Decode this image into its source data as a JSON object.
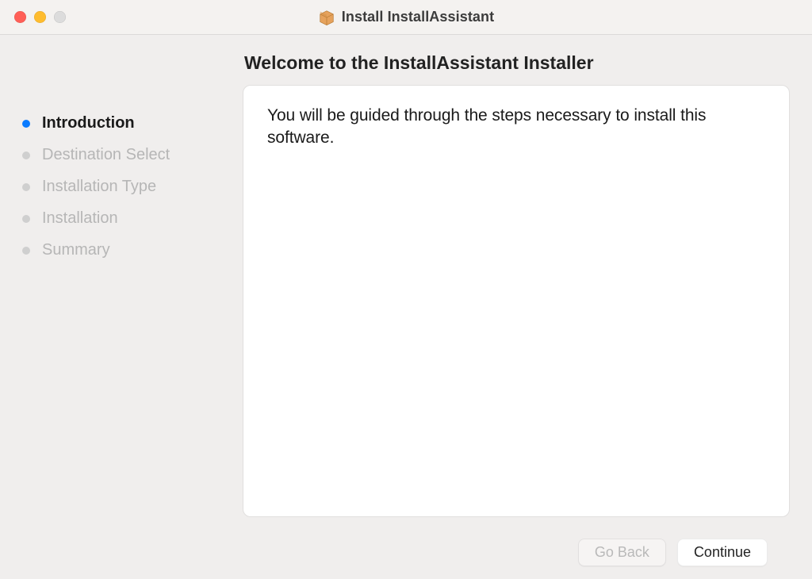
{
  "window": {
    "title": "Install InstallAssistant"
  },
  "sidebar": {
    "steps": [
      {
        "label": "Introduction",
        "active": true
      },
      {
        "label": "Destination Select",
        "active": false
      },
      {
        "label": "Installation Type",
        "active": false
      },
      {
        "label": "Installation",
        "active": false
      },
      {
        "label": "Summary",
        "active": false
      }
    ]
  },
  "main": {
    "heading": "Welcome to the InstallAssistant Installer",
    "body_text": "You will be guided through the steps necessary to install this software."
  },
  "footer": {
    "go_back_label": "Go Back",
    "continue_label": "Continue"
  }
}
